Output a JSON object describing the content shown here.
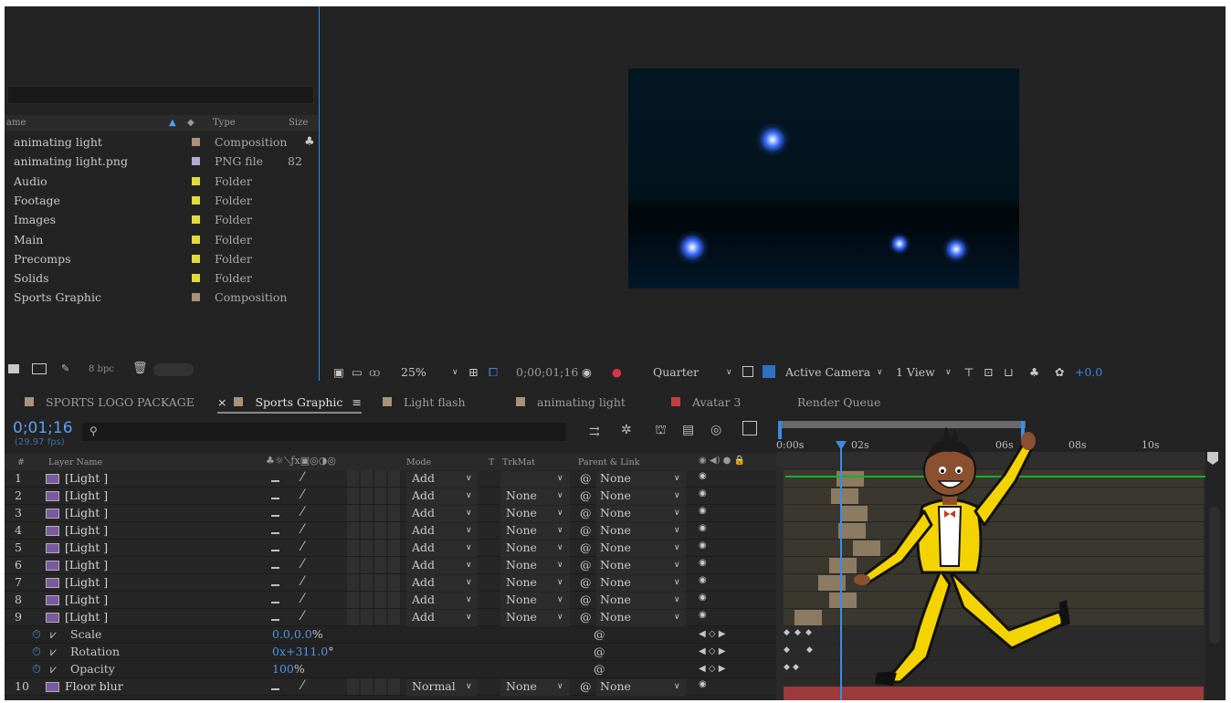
{
  "project": {
    "columns": {
      "name": "ame",
      "type": "Type",
      "size": "Size"
    },
    "items": [
      {
        "name": "animating light",
        "type": "Composition",
        "size": "",
        "color": "#a8927a"
      },
      {
        "name": "animating light.png",
        "type": "PNG file",
        "size": "82",
        "color": "#b3a9d8"
      },
      {
        "name": "Audio",
        "type": "Folder",
        "size": "",
        "color": "#e4d93a"
      },
      {
        "name": "Footage",
        "type": "Folder",
        "size": "",
        "color": "#e4d93a"
      },
      {
        "name": "Images",
        "type": "Folder",
        "size": "",
        "color": "#e4d93a"
      },
      {
        "name": "Main",
        "type": "Folder",
        "size": "",
        "color": "#e4d93a"
      },
      {
        "name": "Precomps",
        "type": "Folder",
        "size": "",
        "color": "#e4d93a"
      },
      {
        "name": "Solids",
        "type": "Folder",
        "size": "",
        "color": "#e4d93a"
      },
      {
        "name": "Sports Graphic",
        "type": "Composition",
        "size": "",
        "color": "#a8927a"
      }
    ],
    "bpc": "8 bpc"
  },
  "viewer": {
    "zoom": "25%",
    "timecode": "0;00;01;16",
    "resolution": "Quarter",
    "camera": "Active Camera",
    "views": "1 View",
    "exposure": "+0.0"
  },
  "tabs": [
    {
      "label": "SPORTS LOGO PACKAGE",
      "color": "#a8927a"
    },
    {
      "label": "Sports Graphic",
      "color": "#a8927a"
    },
    {
      "label": "Light flash",
      "color": "#a8927a"
    },
    {
      "label": "animating light",
      "color": "#a8927a"
    },
    {
      "label": "Avatar 3",
      "color": "#c43d3d"
    },
    {
      "label": "Render Queue",
      "color": ""
    }
  ],
  "timeline": {
    "timecode": "0;01;16",
    "fps": "(29.97 fps)",
    "columns": {
      "num": "#",
      "layer": "Layer Name",
      "mode": "Mode",
      "t": "T",
      "trkmat": "TrkMat",
      "parent": "Parent & Link"
    },
    "layers": [
      {
        "num": "1",
        "name": "[Light ]",
        "mode": "Add",
        "trkmat": "",
        "parent": "None"
      },
      {
        "num": "2",
        "name": "[Light ]",
        "mode": "Add",
        "trkmat": "None",
        "parent": "None"
      },
      {
        "num": "3",
        "name": "[Light ]",
        "mode": "Add",
        "trkmat": "None",
        "parent": "None"
      },
      {
        "num": "4",
        "name": "[Light ]",
        "mode": "Add",
        "trkmat": "None",
        "parent": "None"
      },
      {
        "num": "5",
        "name": "[Light ]",
        "mode": "Add",
        "trkmat": "None",
        "parent": "None"
      },
      {
        "num": "6",
        "name": "[Light ]",
        "mode": "Add",
        "trkmat": "None",
        "parent": "None"
      },
      {
        "num": "7",
        "name": "[Light ]",
        "mode": "Add",
        "trkmat": "None",
        "parent": "None"
      },
      {
        "num": "8",
        "name": "[Light ]",
        "mode": "Add",
        "trkmat": "None",
        "parent": "None"
      },
      {
        "num": "9",
        "name": "[Light ]",
        "mode": "Add",
        "trkmat": "None",
        "parent": "None"
      }
    ],
    "properties": [
      {
        "name": "Scale",
        "value": "0.0,0.0",
        "suffix": "%"
      },
      {
        "name": "Rotation",
        "value": "0x+311.0",
        "suffix": "°"
      },
      {
        "name": "Opacity",
        "value": "100",
        "suffix": "%"
      }
    ],
    "layer10": {
      "num": "10",
      "name": "Floor blur",
      "mode": "Normal",
      "trkmat": "None",
      "parent": "None"
    },
    "ruler": [
      "0:00s",
      "02s",
      "06s",
      "08s",
      "10s"
    ]
  }
}
